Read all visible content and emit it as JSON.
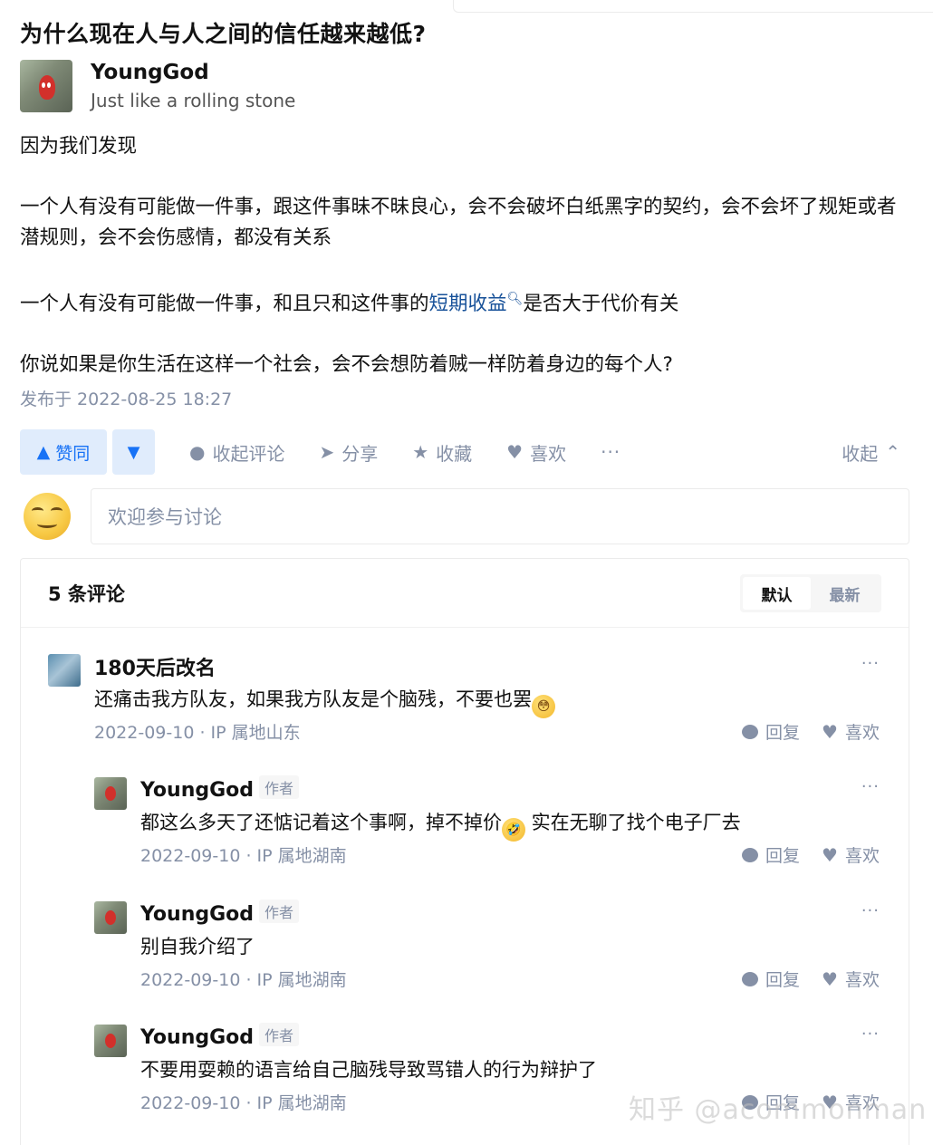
{
  "question": {
    "title": "为什么现在人与人之间的信任越来越低?"
  },
  "author": {
    "name": "YoungGod",
    "bio": "Just like a rolling stone"
  },
  "answer": {
    "p1": "因为我们发现",
    "p2": "一个人有没有可能做一件事，跟这件事昧不昧良心，会不会破坏白纸黑字的契约，会不会坏了规矩或者潜规则，会不会伤感情，都没有关系",
    "p3_before": "一个人有没有可能做一件事，和且只和这件事的",
    "p3_link": "短期收益",
    "p3_after": "是否大于代价有关",
    "p4": "你说如果是你生活在这样一个社会，会不会想防着贼一样防着身边的每个人?",
    "published": "发布于 2022-08-25 18:27"
  },
  "actions": {
    "upvote": "赞同",
    "collapse_comments": "收起评论",
    "share": "分享",
    "favorite": "收藏",
    "like": "喜欢",
    "more": "···",
    "collapse": "收起"
  },
  "comment_input": {
    "placeholder": "欢迎参与讨论"
  },
  "comments_section": {
    "count": "5 条评论",
    "sort_default": "默认",
    "sort_latest": "最新",
    "reply_label": "回复",
    "like_label": "喜欢",
    "author_tag": "作者",
    "items": [
      {
        "name": "180天后改名",
        "text": "还痛击我方队友，如果我方队友是个脑残，不要也罢",
        "date": "2022-09-10",
        "ip": "IP 属地山东"
      },
      {
        "name": "YoungGod",
        "text_before": "都这么多天了还惦记着这个事啊，掉不掉价",
        "text_after": " 实在无聊了找个电子厂去",
        "date": "2022-09-10",
        "ip": "IP 属地湖南"
      },
      {
        "name": "YoungGod",
        "text": "别自我介绍了",
        "date": "2022-09-10",
        "ip": "IP 属地湖南"
      },
      {
        "name": "YoungGod",
        "text": "不要用耍赖的语言给自己脑残导致骂错人的行为辩护了",
        "date": "2022-09-10",
        "ip": "IP 属地湖南"
      }
    ]
  },
  "watermark": "知乎 @acommonman"
}
